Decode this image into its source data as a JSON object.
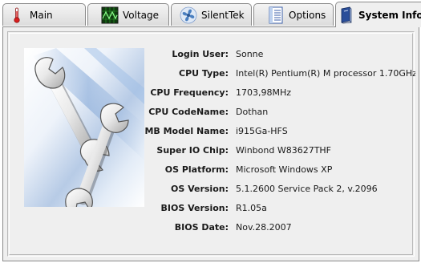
{
  "tabs": [
    {
      "label": "Main",
      "icon": "thermometer-icon",
      "active": false
    },
    {
      "label": "Voltage",
      "icon": "oscilloscope-icon",
      "active": false
    },
    {
      "label": "SilentTek",
      "icon": "fan-icon",
      "active": false
    },
    {
      "label": "Options",
      "icon": "options-list-icon",
      "active": false
    },
    {
      "label": "System Info",
      "icon": "book-icon",
      "active": true
    }
  ],
  "image": {
    "icon": "wrenches-icon"
  },
  "info": [
    {
      "key": "Login User:",
      "value": "Sonne"
    },
    {
      "key": "CPU Type:",
      "value": "Intel(R) Pentium(R) M processor 1.70GHz"
    },
    {
      "key": "CPU Frequency:",
      "value": "1703,98MHz"
    },
    {
      "key": "CPU CodeName:",
      "value": "Dothan"
    },
    {
      "key": "MB Model Name:",
      "value": "i915Ga-HFS"
    },
    {
      "key": "Super IO Chip:",
      "value": "Winbond W83627THF"
    },
    {
      "key": "OS Platform:",
      "value": "Microsoft Windows XP"
    },
    {
      "key": "OS Version:",
      "value": "5.1.2600 Service Pack 2, v.2096"
    },
    {
      "key": "BIOS Version:",
      "value": "R1.05a"
    },
    {
      "key": "BIOS Date:",
      "value": "Nov.28.2007"
    }
  ],
  "colors": {
    "panel_bg": "#efefef",
    "border": "#8a8a8a",
    "thermometer": "#d81e1e",
    "oscilloscope": "#1a8f1a",
    "fan": "#4a7fc0",
    "book": "#2a4e9a"
  }
}
